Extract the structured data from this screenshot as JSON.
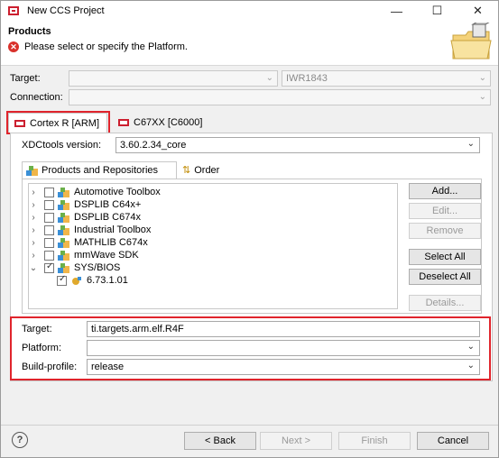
{
  "window": {
    "title": "New CCS Project"
  },
  "header": {
    "title": "Products",
    "message": "Please select or specify the Platform."
  },
  "target": {
    "label": "Target:",
    "value": "",
    "value2": "IWR1843"
  },
  "connection": {
    "label": "Connection:",
    "value": ""
  },
  "tabs": [
    {
      "label": "Cortex R [ARM]"
    },
    {
      "label": "C67XX [C6000]"
    }
  ],
  "xdc": {
    "label": "XDCtools version:",
    "value": "3.60.2.34_core"
  },
  "inner_tabs": [
    {
      "label": "Products and Repositories"
    },
    {
      "label": "Order"
    }
  ],
  "tree": {
    "items": [
      {
        "label": "Automotive Toolbox"
      },
      {
        "label": "DSPLIB C64x+"
      },
      {
        "label": "DSPLIB C674x"
      },
      {
        "label": "Industrial Toolbox"
      },
      {
        "label": "MATHLIB C674x"
      },
      {
        "label": "mmWave SDK"
      },
      {
        "label": "SYS/BIOS"
      },
      {
        "label": "6.73.1.01"
      }
    ]
  },
  "side_buttons": {
    "add": "Add...",
    "edit": "Edit...",
    "remove": "Remove",
    "select_all": "Select All",
    "deselect_all": "Deselect All",
    "details": "Details..."
  },
  "bottom_fields": {
    "target_label": "Target:",
    "target_value": "ti.targets.arm.elf.R4F",
    "platform_label": "Platform:",
    "platform_value": "",
    "build_label": "Build-profile:",
    "build_value": "release"
  },
  "footer": {
    "back": "< Back",
    "next": "Next >",
    "finish": "Finish",
    "cancel": "Cancel",
    "help": "?"
  },
  "colors": {
    "highlight": "#e0242c",
    "error": "#d9312b"
  }
}
